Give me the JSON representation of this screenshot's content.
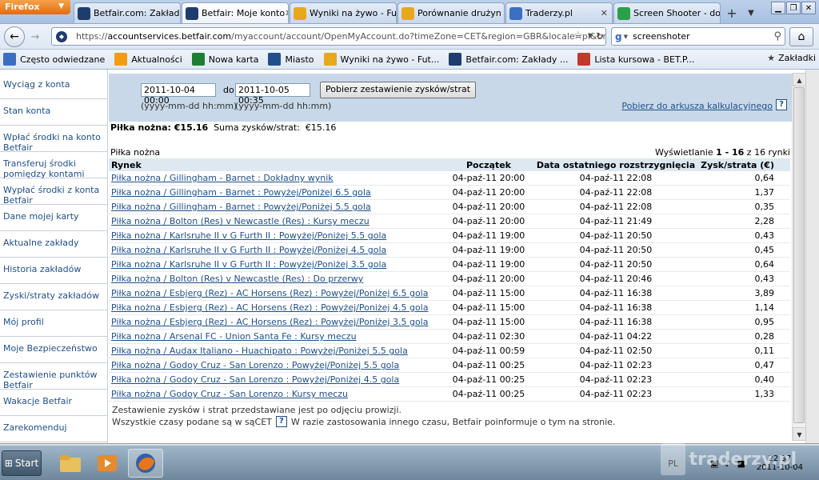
{
  "browser": {
    "app_button": "Firefox",
    "tabs": [
      {
        "label": "Betfair.com: Zakład...",
        "icon_color": "#1f3c6e",
        "active": false
      },
      {
        "label": "Betfair: Moje konto",
        "icon_color": "#1f3c6e",
        "active": true
      },
      {
        "label": "Wyniki na żywo - Fu...",
        "icon_color": "#e8a81b",
        "active": false
      },
      {
        "label": "Porównanie drużyn ...",
        "icon_color": "#e8a81b",
        "active": false
      },
      {
        "label": "Traderzy.pl",
        "icon_color": "#3a6fc4",
        "active": false
      },
      {
        "label": "Screen Shooter - do...",
        "icon_color": "#2aa148",
        "active": false
      }
    ],
    "url_scheme": "https://",
    "url_host": "accountservices.betfair.com",
    "url_rest": "/myaccount/account/OpenMyAccount.do?timeZone=CET&region=GBR&locale=pl&branc",
    "search_value": "screenshoter",
    "bookmarks": [
      {
        "label": "Często odwiedzane",
        "icon_color": "#3a6fc4"
      },
      {
        "label": "Aktualności",
        "icon_color": "#f39c12"
      },
      {
        "label": "Nowa karta",
        "icon_color": "#1e7d32"
      },
      {
        "label": "Miasto",
        "icon_color": "#234e8c"
      },
      {
        "label": "Wyniki na żywo - Fut...",
        "icon_color": "#e8a81b"
      },
      {
        "label": "Betfair.com: Zakłady ...",
        "icon_color": "#1f3c6e"
      },
      {
        "label": "Lista kursowa - BET.P...",
        "icon_color": "#c0392b"
      }
    ],
    "bookmarks_menu": "Zakładki"
  },
  "sidebar": {
    "items": [
      {
        "label": "Wyciąg z konta"
      },
      {
        "label": "Stan konta"
      },
      {
        "label": "Wpłać środki na konto Betfair"
      },
      {
        "label": "Transferuj środki pomiędzy kontami"
      },
      {
        "label": "Wypłać środki z konta Betfair"
      },
      {
        "label": "Dane mojej karty"
      },
      {
        "label": "Aktualne zakłady"
      },
      {
        "label": "Historia zakładów"
      },
      {
        "label": "Zyski/straty zakładów",
        "active": true
      },
      {
        "label": "Mój profil"
      },
      {
        "label": "Moje Bezpieczeństwo"
      },
      {
        "label": "Zestawienie punktów Betfair"
      },
      {
        "label": "Wakacje Betfair"
      },
      {
        "label": "Zarekomenduj"
      }
    ]
  },
  "filter": {
    "from_value": "2011-10-04 00:00",
    "to_label": "do",
    "to_value": "2011-10-05 00:35",
    "format_hint": "(yyyy-mm-dd hh:mm)",
    "fetch_button": "Pobierz zestawienie zysków/strat",
    "spreadsheet_link": "Pobierz do arkusza kalkulacyjnego",
    "help": "?"
  },
  "summary": {
    "sport_total": "Piłka nożna: €15.16",
    "sum_label": "Suma zysków/strat:",
    "sum_value": "€15.16"
  },
  "section_label": "Piłka nożna",
  "showing": {
    "prefix": "Wyświetlanie",
    "range": "1 - 16",
    "suffix": "z 16 rynki"
  },
  "table": {
    "headers": {
      "market": "Rynek",
      "start": "Początek",
      "settled": "Data ostatniego rozstrzygnięcia",
      "pl": "Zysk/strata (€)"
    },
    "rows": [
      {
        "market": "Piłka nożna / Gillingham - Barnet : Dokładny wynik",
        "start": "04-paź-11 20:00",
        "settled": "04-paź-11 22:08",
        "pl": "0,64"
      },
      {
        "market": "Piłka nożna / Gillingham - Barnet : Powyżej/Poniżej 6.5 gola",
        "start": "04-paź-11 20:00",
        "settled": "04-paź-11 22:08",
        "pl": "1,37"
      },
      {
        "market": "Piłka nożna / Gillingham - Barnet : Powyżej/Poniżej 5.5 gola",
        "start": "04-paź-11 20:00",
        "settled": "04-paź-11 22:08",
        "pl": "0,35"
      },
      {
        "market": "Piłka nożna / Bolton (Res) v Newcastle (Res) : Kursy meczu",
        "start": "04-paź-11 20:00",
        "settled": "04-paź-11 21:49",
        "pl": "2,28"
      },
      {
        "market": "Piłka nożna / Karlsruhe II v G Furth II : Powyżej/Poniżej 5.5 gola",
        "start": "04-paź-11 19:00",
        "settled": "04-paź-11 20:50",
        "pl": "0,43"
      },
      {
        "market": "Piłka nożna / Karlsruhe II v G Furth II : Powyżej/Poniżej 4.5 gola",
        "start": "04-paź-11 19:00",
        "settled": "04-paź-11 20:50",
        "pl": "0,45"
      },
      {
        "market": "Piłka nożna / Karlsruhe II v G Furth II : Powyżej/Poniżej 3.5 gola",
        "start": "04-paź-11 19:00",
        "settled": "04-paź-11 20:50",
        "pl": "0,64"
      },
      {
        "market": "Piłka nożna / Bolton (Res) v Newcastle (Res) : Do przerwy",
        "start": "04-paź-11 20:00",
        "settled": "04-paź-11 20:46",
        "pl": "0,43"
      },
      {
        "market": "Piłka nożna / Esbjerg (Rez) - AC Horsens (Rez) : Powyżej/Poniżej 6.5 gola",
        "start": "04-paź-11 15:00",
        "settled": "04-paź-11 16:38",
        "pl": "3,89"
      },
      {
        "market": "Piłka nożna / Esbjerg (Rez) - AC Horsens (Rez) : Powyżej/Poniżej 4.5 gola",
        "start": "04-paź-11 15:00",
        "settled": "04-paź-11 16:38",
        "pl": "1,14"
      },
      {
        "market": "Piłka nożna / Esbjerg (Rez) - AC Horsens (Rez) : Powyżej/Poniżej 3.5 gola",
        "start": "04-paź-11 15:00",
        "settled": "04-paź-11 16:38",
        "pl": "0,95"
      },
      {
        "market": "Piłka nożna / Arsenal FC - Union Santa Fe : Kursy meczu",
        "start": "04-paź-11 02:30",
        "settled": "04-paź-11 04:22",
        "pl": "0,28"
      },
      {
        "market": "Piłka nożna / Audax Italiano - Huachipato : Powyżej/Poniżej 5.5 gola",
        "start": "04-paź-11 00:59",
        "settled": "04-paź-11 02:50",
        "pl": "0,11"
      },
      {
        "market": "Piłka nożna / Godoy Cruz - San Lorenzo : Powyżej/Poniżej 5.5 gola",
        "start": "04-paź-11 00:25",
        "settled": "04-paź-11 02:23",
        "pl": "0,47"
      },
      {
        "market": "Piłka nożna / Godoy Cruz - San Lorenzo : Powyżej/Poniżej 4.5 gola",
        "start": "04-paź-11 00:25",
        "settled": "04-paź-11 02:23",
        "pl": "0,40"
      },
      {
        "market": "Piłka nożna / Godoy Cruz - San Lorenzo : Kursy meczu",
        "start": "04-paź-11 00:25",
        "settled": "04-paź-11 02:23",
        "pl": "1,33"
      }
    ]
  },
  "footer": {
    "line1": "Zestawienie zysków i strat przedstawiane jest po odjęciu prowizji.",
    "line2a": "Wszystkie czasy podane są w sąCET",
    "line2b": "W razie zastosowania innego czasu, Betfair poinformuje o tym na stronie."
  },
  "taskbar": {
    "start_label": "Start",
    "language": "PL",
    "time": "22:37",
    "date": "2011-10-04"
  },
  "watermark": "traderzy.pl"
}
